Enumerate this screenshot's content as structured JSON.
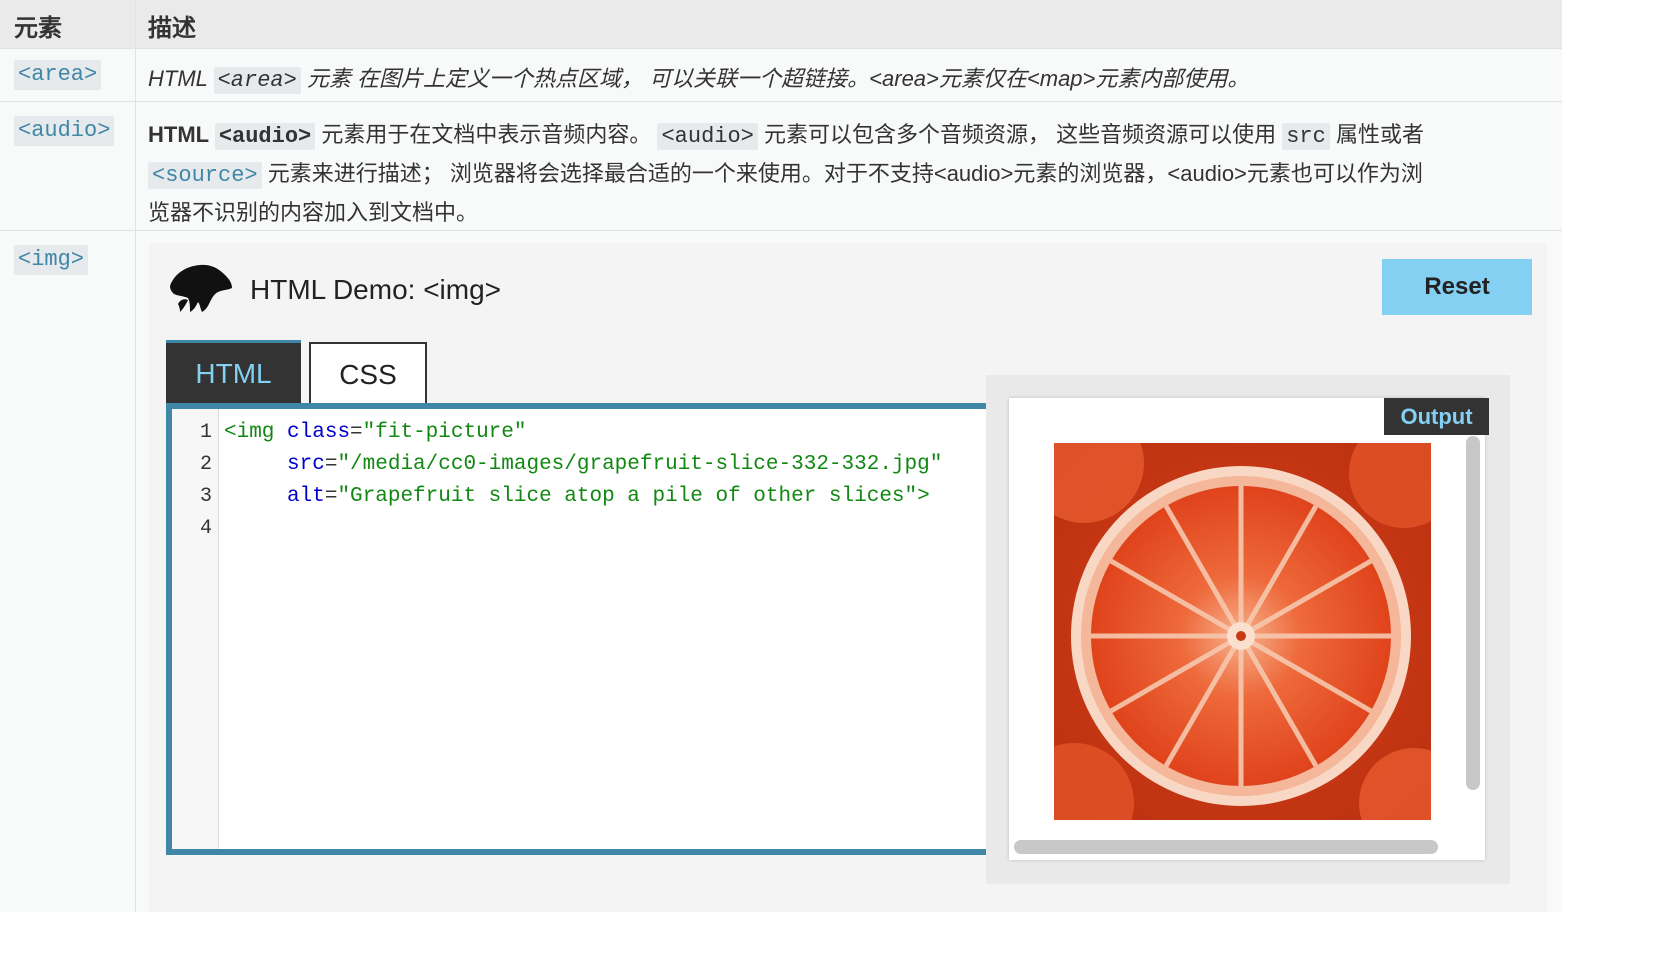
{
  "table": {
    "header": {
      "col1": "元素",
      "col2": "描述"
    },
    "rows": [
      {
        "tag": "<area>",
        "desc_prefix": "HTML ",
        "desc_code": "<area>",
        "desc_suffix": " 元素 在图片上定义一个热点区域， 可以关联一个超链接。<area>元素仅在<map>元素内部使用。"
      },
      {
        "tag": "<audio>",
        "line1_prefix": "HTML ",
        "line1_code1": "<audio>",
        "line1_text1": " 元素用于在文档中表示音频内容。 ",
        "line1_code2": "<audio>",
        "line1_text2": " 元素可以包含多个音频资源， 这些音频资源可以使用 ",
        "line1_code3": "src",
        "line1_text3": " 属性或者",
        "line2_code": "<source>",
        "line2_text": " 元素来进行描述； 浏览器将会选择最合适的一个来使用。对于不支持<audio>元素的浏览器，<audio>元素也可以作为浏",
        "line3_text": "览器不识别的内容加入到文档中。"
      },
      {
        "tag": "<img>"
      }
    ]
  },
  "demo": {
    "title": "HTML Demo: <img>",
    "reset_label": "Reset",
    "tabs": [
      "HTML",
      "CSS"
    ],
    "active_tab": "HTML",
    "output_label": "Output",
    "image_alt": "Grapefruit slice atop a pile of other slices",
    "code_lines": [
      {
        "n": "1",
        "tag": "<img",
        "attr": "class",
        "value": "\"fit-picture\""
      },
      {
        "n": "2",
        "attr": "src",
        "value": "\"/media/cc0-images/grapefruit-slice-332-332.jpg\""
      },
      {
        "n": "3",
        "attr": "alt",
        "value": "\"Grapefruit slice atop a pile of other slices\"",
        "close": ">"
      },
      {
        "n": "4"
      }
    ],
    "colors": {
      "accent": "#83d0f2",
      "editor_border": "#3f87a6",
      "tab_bg": "#333333"
    }
  }
}
